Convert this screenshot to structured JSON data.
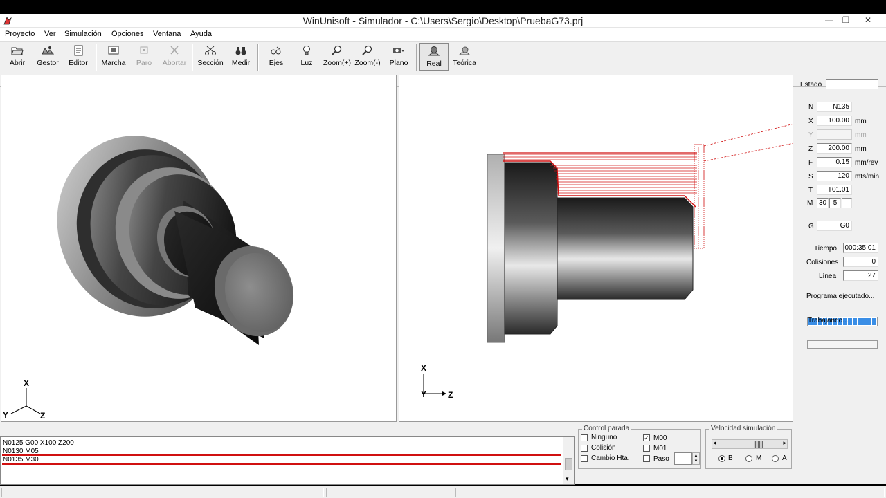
{
  "window": {
    "title": "WinUnisoft - Simulador - C:\\Users\\Sergio\\Desktop\\PruebaG73.prj"
  },
  "menu": [
    "Proyecto",
    "Ver",
    "Simulación",
    "Opciones",
    "Ventana",
    "Ayuda"
  ],
  "toolbar": {
    "abrir": "Abrir",
    "gestor": "Gestor",
    "editor": "Editor",
    "marcha": "Marcha",
    "paro": "Paro",
    "abortar": "Abortar",
    "seccion": "Sección",
    "medir": "Medir",
    "ejes": "Ejes",
    "luz": "Luz",
    "zoom_in": "Zoom(+)",
    "zoom_out": "Zoom(-)",
    "plano": "Plano",
    "real": "Real",
    "teorica": "Teórica"
  },
  "axes_left": {
    "x": "X",
    "y": "Y",
    "z": "Z"
  },
  "axes_right": {
    "x": "X",
    "z": "Z"
  },
  "panel": {
    "estado_label": "Estado",
    "estado_value": "",
    "n_label": "N",
    "n_value": "N135",
    "x_label": "X",
    "x_value": "100.00",
    "x_unit": "mm",
    "y_label": "Y",
    "y_value": "",
    "y_unit": "mm",
    "z_label": "Z",
    "z_value": "200.00",
    "z_unit": "mm",
    "f_label": "F",
    "f_value": "0.15",
    "f_unit": "mm/rev",
    "s_label": "S",
    "s_value": "120",
    "s_unit": "mts/min",
    "t_label": "T",
    "t_value": "T01.01",
    "m_label": "M",
    "m_value1": "30",
    "m_value2": "5",
    "m_value3": "",
    "g_label": "G",
    "g_value": "G0",
    "tiempo_label": "Tiempo",
    "tiempo_value": "000:35:01",
    "colisiones_label": "Colisiones",
    "colisiones_value": "0",
    "linea_label": "Línea",
    "linea_value": "27",
    "programa_label": "Programa ejecutado...",
    "programa_progress": 1.0,
    "trabajando_label": "Trabajando...",
    "trabajando_progress": 0.0
  },
  "code_lines": [
    "N0125 G00 X100 Z200",
    "N0130 M05",
    "N0135 M30"
  ],
  "control_parada": {
    "title": "Control parada",
    "ninguno": "Ninguno",
    "colision": "Colisión",
    "cambio": "Cambio Hta.",
    "m00": "M00",
    "m01": "M01",
    "paso": "Paso",
    "m00_checked": "✓"
  },
  "velocidad": {
    "title": "Velocidad simulación",
    "b": "B",
    "m": "M",
    "a": "A"
  },
  "colors": {
    "accent_red": "#d01010",
    "progress_blue": "#3a8ee6"
  }
}
